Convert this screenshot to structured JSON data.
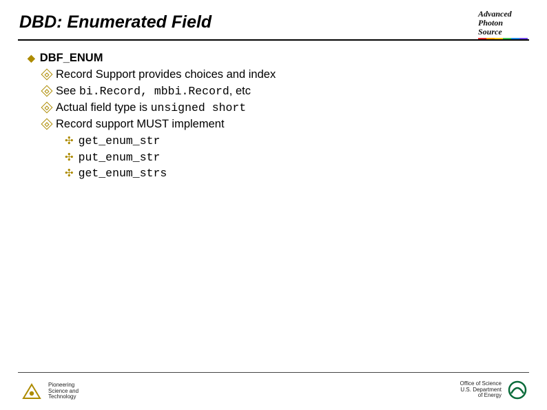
{
  "title": "DBD: Enumerated Field",
  "top_logo_line1": "Advanced",
  "top_logo_line2": "Photon",
  "top_logo_line3": "Source",
  "h1": "DBF_ENUM",
  "b1_pre": "Record Support provides choices and index",
  "b2_pre": "See ",
  "b2_code": "bi.Record, mbbi.Record",
  "b2_post": ", etc",
  "b3_pre": "Actual field type is ",
  "b3_code": "unsigned short",
  "b4_pre": "Record support MUST implement",
  "c1": "get_enum_str",
  "c2": "put_enum_str",
  "c3": "get_enum_strs",
  "footer_left_l1": "Pioneering",
  "footer_left_l2": "Science and",
  "footer_left_l3": "Technology",
  "footer_right_l1": "Office of Science",
  "footer_right_l2": "U.S. Department",
  "footer_right_l3": "of Energy"
}
